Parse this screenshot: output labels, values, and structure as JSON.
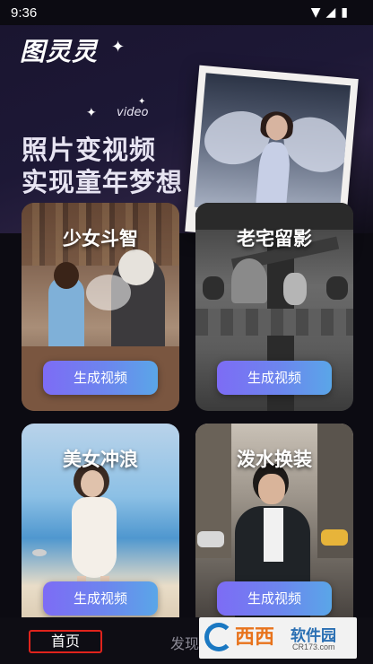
{
  "status_bar": {
    "time": "9:36",
    "icons": [
      "wifi-icon",
      "signal-icon",
      "battery-icon"
    ]
  },
  "hero": {
    "logo": "图灵灵",
    "logo_sparkle": "✦",
    "tag": "video",
    "line1": "照片变视频",
    "line2": "实现童年梦想"
  },
  "cards": [
    {
      "title": "少女斗智",
      "button": "生成视频"
    },
    {
      "title": "老宅留影",
      "button": "生成视频"
    },
    {
      "title": "美女冲浪",
      "button": "生成视频"
    },
    {
      "title": "泼水换装",
      "button": "生成视频"
    }
  ],
  "tabbar": {
    "home": "首页",
    "discover": "发现"
  },
  "watermark": {
    "brand": "西西",
    "name": "软件园",
    "url": "CR173.com"
  },
  "colors": {
    "background": "#0c0b12",
    "button_gradient_start": "#7d6cf5",
    "button_gradient_end": "#5aa6e8",
    "home_highlight": "#e0231c"
  }
}
